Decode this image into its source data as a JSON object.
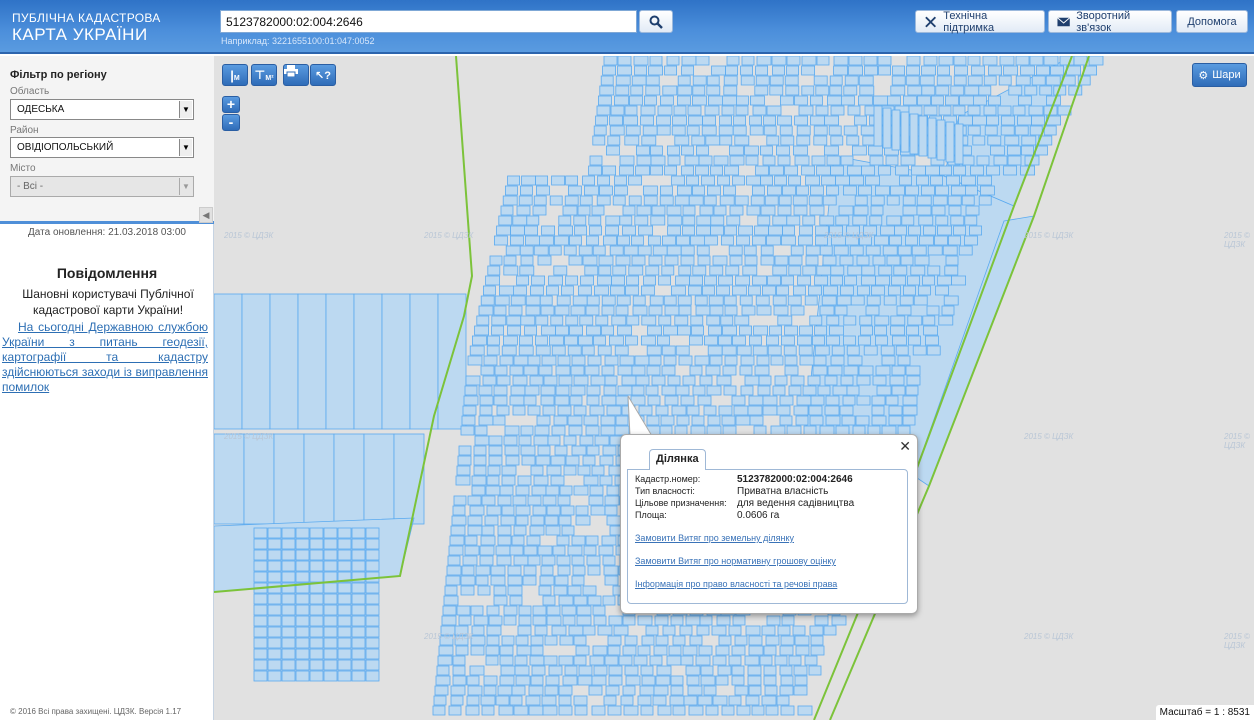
{
  "header": {
    "logo_line1": "ПУБЛІЧНА КАДАСТРОВА",
    "logo_line2": "КАРТА УКРАЇНИ",
    "search_value": "5123782000:02:004:2646",
    "search_hint": "Наприклад: 3221655100:01:047:0052",
    "buttons": {
      "support": "Технічна підтримка",
      "feedback": "Зворотний зв'язок",
      "help": "Допомога"
    }
  },
  "sidebar": {
    "filter_title": "Фільтр по регіону",
    "region_label": "Область",
    "region_value": "ОДЕСЬКА",
    "district_label": "Район",
    "district_value": "ОВІДІОПОЛЬСЬКИЙ",
    "city_label": "Місто",
    "city_value": "- Всі -",
    "update_date": "Дата оновлення: 21.03.2018 03:00",
    "message_title": "Повідомлення",
    "message_text": "Шановні користувачі Публічної кадастрової карти України!",
    "message_link": "На сьогодні Державною службою України з питань геодезії, картографії та кадастру здійснюються заходи із виправлення помилок",
    "copyright": "© 2016 Всі права захищені. ЦДЗК. Версія 1.17"
  },
  "map": {
    "layers_label": "Шари",
    "watermark": "2015 © ЦДЗК",
    "scale": "Масштаб = 1 : 8531",
    "tools": {
      "measure_length": "М",
      "measure_area": "М²"
    }
  },
  "popup": {
    "tab_label": "Ділянка",
    "fields": [
      {
        "key": "Кадастр.номер:",
        "value": "5123782000:02:004:2646"
      },
      {
        "key": "Тип власності:",
        "value": "Приватна власність"
      },
      {
        "key": "Цільове призначення:",
        "value": "для ведення садівництва"
      },
      {
        "key": "Площа:",
        "value": "0.0606 га"
      }
    ],
    "links": [
      "Замовити Витяг про земельну ділянку",
      "Замовити Витяг про нормативну грошову оцінку",
      "Інформація про право власності та речові права"
    ]
  },
  "colors": {
    "header_blue": "#4c8fdb",
    "parcel_fill": "#bcd9f1",
    "parcel_stroke": "#5aaaf0",
    "boundary_green": "#7cc33a",
    "link_blue": "#3a73b8"
  }
}
